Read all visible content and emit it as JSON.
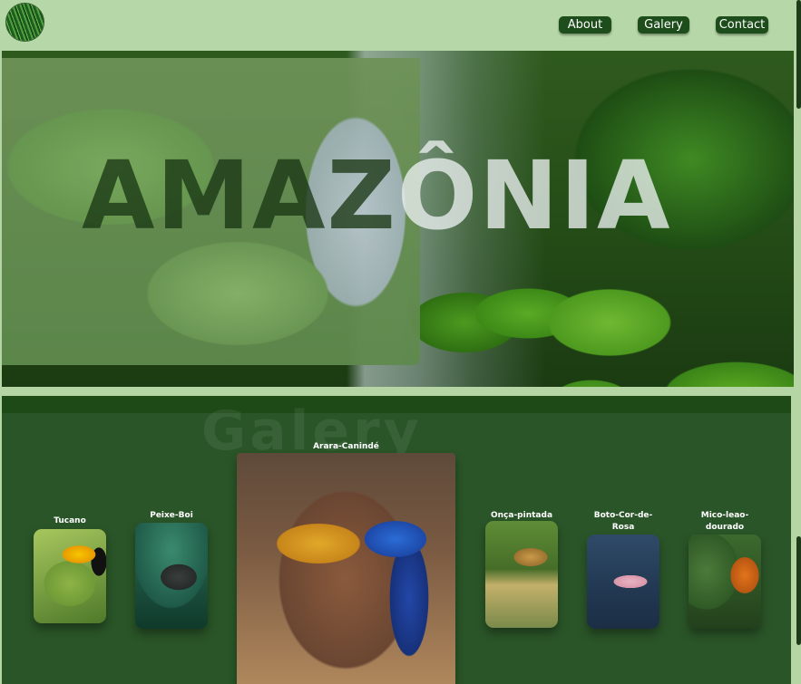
{
  "header": {
    "logo_icon": "forest-logo-icon",
    "nav": [
      {
        "label": "About"
      },
      {
        "label": "Galery"
      },
      {
        "label": "Contact"
      }
    ]
  },
  "hero": {
    "title_left": "AMAZ",
    "title_right": "ÔNIA"
  },
  "gallery": {
    "title": "Galery",
    "cards": [
      {
        "label": "Tucano",
        "image": "toucan-image"
      },
      {
        "label": "Peixe-Boi",
        "image": "manatee-image"
      },
      {
        "label": "Arara-Canindé",
        "image": "macaw-image"
      },
      {
        "label": "Onça-pintada",
        "image": "jaguar-image"
      },
      {
        "label": "Boto-Cor-de-Rosa",
        "image": "pink-dolphin-image"
      },
      {
        "label": "Mico-leao-dourado",
        "image": "golden-tamarin-image"
      }
    ]
  },
  "colors": {
    "header_bg": "#b6d7a7",
    "nav_button_bg": "#1d4d1a",
    "gallery_bg": "#2a5528"
  }
}
